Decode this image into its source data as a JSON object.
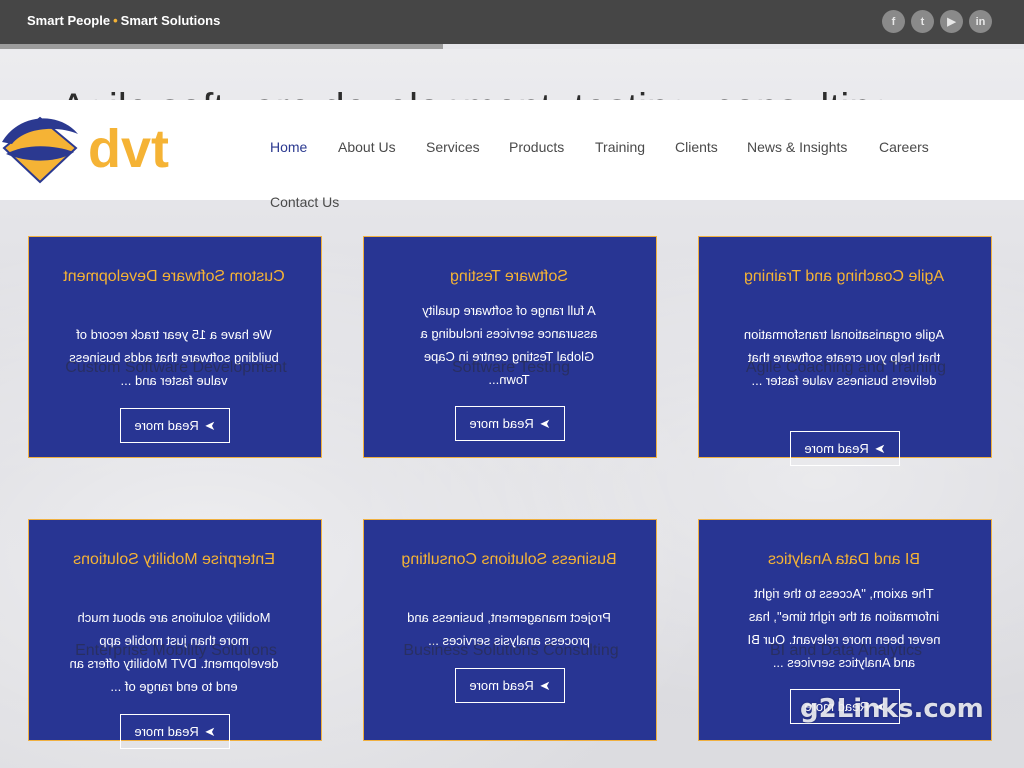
{
  "topbar": {
    "tagline_part1": "Smart People",
    "tagline_separator": "•",
    "tagline_part2": "Smart Solutions",
    "social": [
      {
        "name": "facebook",
        "glyph": "f"
      },
      {
        "name": "twitter",
        "glyph": "t"
      },
      {
        "name": "youtube",
        "glyph": "▶"
      },
      {
        "name": "linkedin",
        "glyph": "in"
      }
    ]
  },
  "hero": {
    "title": "Agile software development, testing, consulting"
  },
  "logo": {
    "text": "dvt"
  },
  "nav": {
    "home": "Home",
    "about": "About Us",
    "services": "Services",
    "products": "Products",
    "training": "Training",
    "clients": "Clients",
    "news": "News & Insights",
    "careers": "Careers",
    "contact": "Contact Us"
  },
  "cards": [
    {
      "title": "Custom Software Development",
      "text": "We have a 15 year track record of building software that adds business value faster and ...",
      "button": "Read more",
      "ghost": "Custom Software Development"
    },
    {
      "title": "Software Testing",
      "text": "A full range of software quality assurance services including a Global Testing centre in Cape Town...",
      "button": "Read more",
      "ghost": "Software Testing"
    },
    {
      "title": "Agile Coaching and Training",
      "text": "Agile organisational transformation that help you create software that delivers business value faster ...",
      "button": "Read more",
      "ghost": "Agile Coaching and Training"
    },
    {
      "title": "Enterprise Mobility Solutions",
      "text": "Mobility solutions are about much more than just mobile app development. DVT Mobility offers an end to end range of ...",
      "button": "Read more",
      "ghost": "Enterprise Mobility Solutions"
    },
    {
      "title": "Business Solutions Consulting",
      "text": "Project management, business and process analysis services ...",
      "button": "Read more",
      "ghost": "Business Solutions Consulting"
    },
    {
      "title": "BI and Data Analytics",
      "text": "The axiom, \"Access to the right information at the right time\", has never been more relevant. Our BI and Analytics services ...",
      "button": "Read more",
      "ghost": "BI and Data Analytics"
    }
  ],
  "watermark": "g2Links.com",
  "colors": {
    "brand_blue": "#283593",
    "brand_gold": "#f5b335",
    "topbar": "#464646"
  }
}
